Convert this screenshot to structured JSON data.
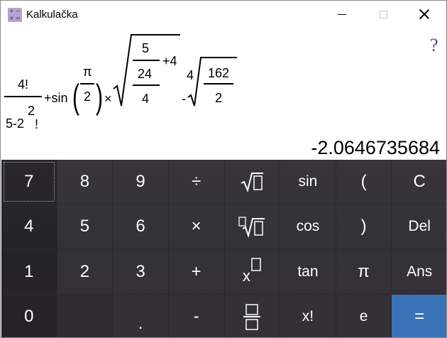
{
  "window": {
    "title": "Kalkulačka",
    "controls": {
      "minimize": "",
      "maximize": "",
      "close": ""
    }
  },
  "display": {
    "help_label": "?",
    "expression": {
      "frac1_num": "4!",
      "frac1_den_base": "5-2",
      "frac1_den_exp": "2",
      "frac1_den_fact": "!",
      "plus_sin": "+sin",
      "lparen": "(",
      "pi_num": "π",
      "pi_den": "2",
      "rparen": ")",
      "times": "×",
      "inner_num": "5",
      "inner_mid": "24",
      "inner_den": "4",
      "plus4": "+4",
      "root_index": "4",
      "minus": "-",
      "root2_num": "162",
      "root2_den": "2"
    },
    "result": "-2.0646735684"
  },
  "keypad": {
    "rows": [
      [
        "7",
        "8",
        "9",
        "÷",
        "sqrt",
        "sin",
        "(",
        "C"
      ],
      [
        "4",
        "5",
        "6",
        "×",
        "nthroot",
        "cos",
        ")",
        "Del"
      ],
      [
        "1",
        "2",
        "3",
        "+",
        "power",
        "tan",
        "π",
        "Ans"
      ],
      [
        "0",
        "",
        ".",
        "-",
        "fraction",
        "x!",
        "e",
        "="
      ]
    ],
    "labels": {
      "k7": "7",
      "k8": "8",
      "k9": "9",
      "div": "÷",
      "sin": "sin",
      "lp": "(",
      "clear": "C",
      "k4": "4",
      "k5": "5",
      "k6": "6",
      "mul": "×",
      "cos": "cos",
      "rp": ")",
      "del": "Del",
      "k1": "1",
      "k2": "2",
      "k3": "3",
      "plus": "+",
      "pow_base": "x",
      "tan": "tan",
      "pi": "π",
      "ans": "Ans",
      "k0": "0",
      "dot": ".",
      "minus": "-",
      "fact": "x!",
      "e": "e",
      "eq": "="
    },
    "accent_color": "#3b73b9"
  }
}
